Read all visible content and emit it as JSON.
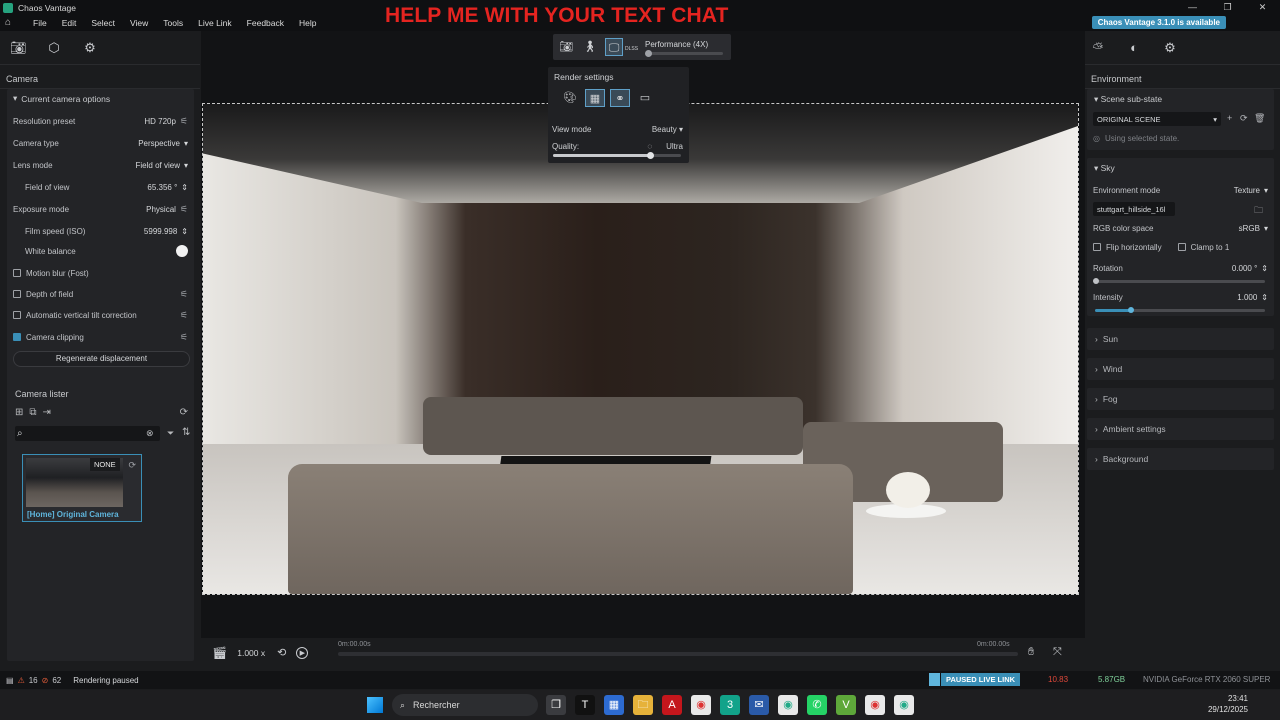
{
  "window": {
    "title": "Chaos Vantage",
    "controls": [
      "—",
      "❐",
      "✕"
    ]
  },
  "menu": {
    "items": [
      "File",
      "Edit",
      "Select",
      "View",
      "Tools",
      "Live Link",
      "Feedback",
      "Help"
    ],
    "overlay_text": "HELP ME WITH YOUR TEXT CHAT",
    "update_badge": "Chaos Vantage 3.1.0 is available"
  },
  "left": {
    "header": "Camera",
    "section": "Current camera options",
    "rows": {
      "resolution_label": "Resolution preset",
      "resolution_value": "HD 720p",
      "cam_type_label": "Camera type",
      "cam_type_value": "Perspective",
      "lens_label": "Lens mode",
      "lens_value": "Field of view",
      "fov_label": "Field of view",
      "fov_value": "65.356 °",
      "exposure_label": "Exposure mode",
      "exposure_value": "Physical",
      "iso_label": "Film speed (ISO)",
      "iso_value": "5999.998",
      "wb_label": "White balance",
      "motion_blur": "Motion blur (Fost)",
      "dof": "Depth of field",
      "tilt": "Automatic vertical tilt correction",
      "clipping": "Camera clipping"
    },
    "regen_button": "Regenerate displacement",
    "lister": {
      "title": "Camera lister",
      "badge": "NONE",
      "camera_name": "[Home] Original Camera"
    }
  },
  "viewport": {
    "performance_label": "Performance (4X)",
    "dlss_label": "DLSS",
    "render_settings_title": "Render settings",
    "view_mode_label": "View mode",
    "view_mode_value": "Beauty",
    "quality_label": "Quality:",
    "quality_value": "Ultra",
    "quality_level": 0.76,
    "performance_level": 0.0
  },
  "timeline": {
    "speed": "1.000 x",
    "start_time": "0m:00.00s",
    "end_time": "0m:00.00s"
  },
  "right": {
    "header": "Environment",
    "scene_substate": "Scene sub-state",
    "original_scene": "ORIGINAL SCENE",
    "using_selected": "Using selected state.",
    "sky": "Sky",
    "env_mode_label": "Environment mode",
    "env_mode_value": "Texture",
    "hdri_file": "stuttgart_hillside_16l",
    "color_space_label": "RGB color space",
    "color_space_value": "sRGB",
    "flip_label": "Flip horizontally",
    "clamp_label": "Clamp to 1",
    "rotation_label": "Rotation",
    "rotation_value": "0.000 °",
    "intensity_label": "Intensity",
    "intensity_value": "1.000",
    "collapsed": [
      "Sun",
      "Wind",
      "Fog",
      "Ambient settings",
      "Background"
    ]
  },
  "status": {
    "warnings": "16",
    "errors": "62",
    "message": "Rendering paused",
    "live_link": "PAUSED LIVE LINK",
    "fps": "10.83",
    "vram": "5.87GB",
    "gpu": "NVIDIA GeForce RTX 2060 SUPER"
  },
  "taskbar": {
    "search_placeholder": "Rechercher",
    "time": "23:41",
    "date": "29/12/2025"
  },
  "colors": {
    "accent": "#3a8fb7",
    "overlay_red": "#e52420",
    "fps_red": "#e0483a",
    "vram_green": "#7fd19a"
  }
}
